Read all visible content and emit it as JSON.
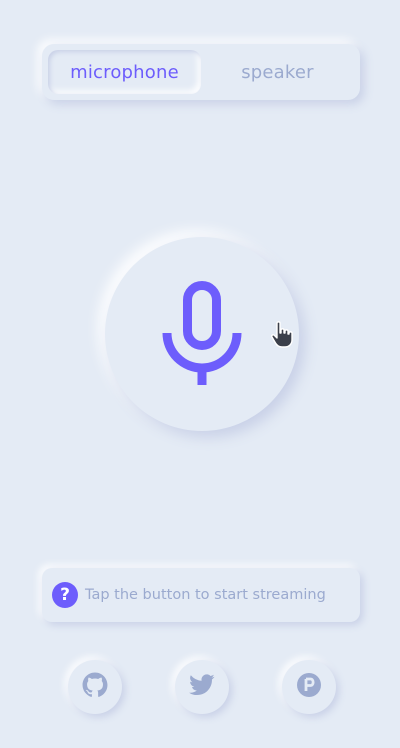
{
  "tabs": [
    {
      "label": "microphone",
      "active": true
    },
    {
      "label": "speaker",
      "active": false
    }
  ],
  "mic_button": {
    "icon": "microphone-icon"
  },
  "hint": {
    "icon": "question-icon",
    "icon_glyph": "?",
    "text": "Tap the button to start streaming"
  },
  "social": [
    {
      "icon": "github-icon"
    },
    {
      "icon": "twitter-icon"
    },
    {
      "icon": "paypal-icon"
    }
  ],
  "colors": {
    "background": "#e4ebf5",
    "accent": "#6d5dfc",
    "muted": "#9baacf"
  }
}
